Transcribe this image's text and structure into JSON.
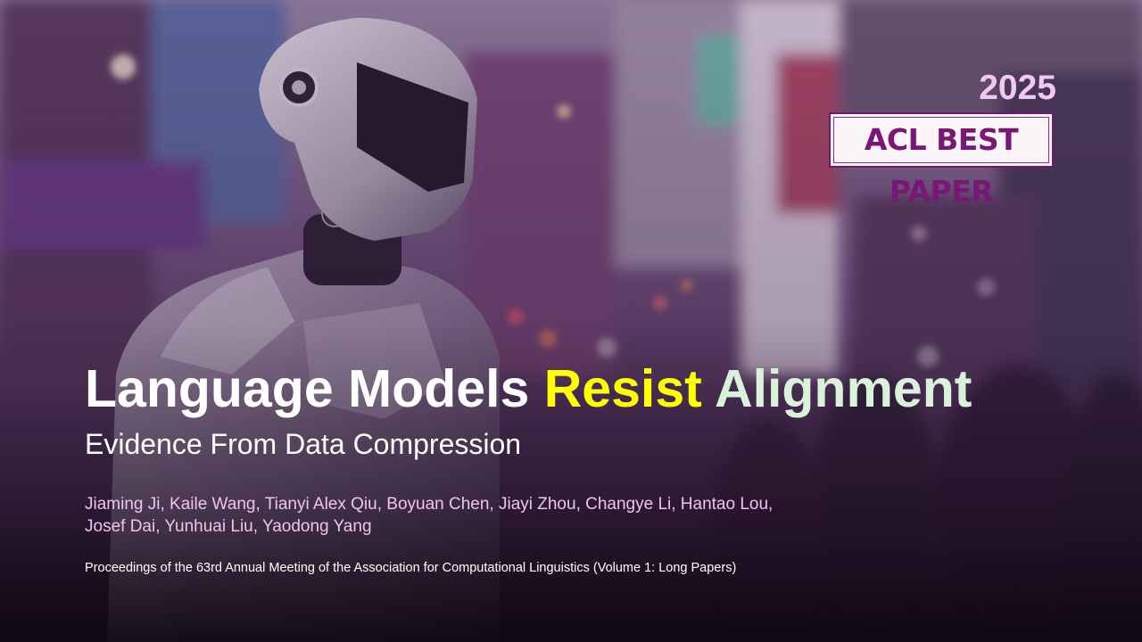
{
  "badge": {
    "year": "2025",
    "label": "ACL BEST PAPER"
  },
  "title": {
    "part1": "Language Models",
    "part2": "Resist",
    "part3": "Alignment"
  },
  "subtitle": "Evidence From Data Compression",
  "authors": {
    "line1": "Jiaming Ji, Kaile Wang, Tianyi Alex Qiu, Boyuan Chen, Jiayi Zhou, Changye Li, Hantao Lou,",
    "line2": "Josef Dai, Yunhuai Liu, Yaodong Yang"
  },
  "venue": "Proceedings of the 63rd Annual Meeting of the Association for Computational Linguistics (Volume 1: Long Papers)",
  "colors": {
    "title": "#ffffff",
    "highlight_resist": "#ffff00",
    "highlight_alignment": "#d9f2d9",
    "authors": "#f0c4ec",
    "badge_year": "#f2c8ee",
    "badge_text": "#7a1676",
    "badge_border": "#6d1a6a",
    "overlay": "#3a1f45"
  }
}
